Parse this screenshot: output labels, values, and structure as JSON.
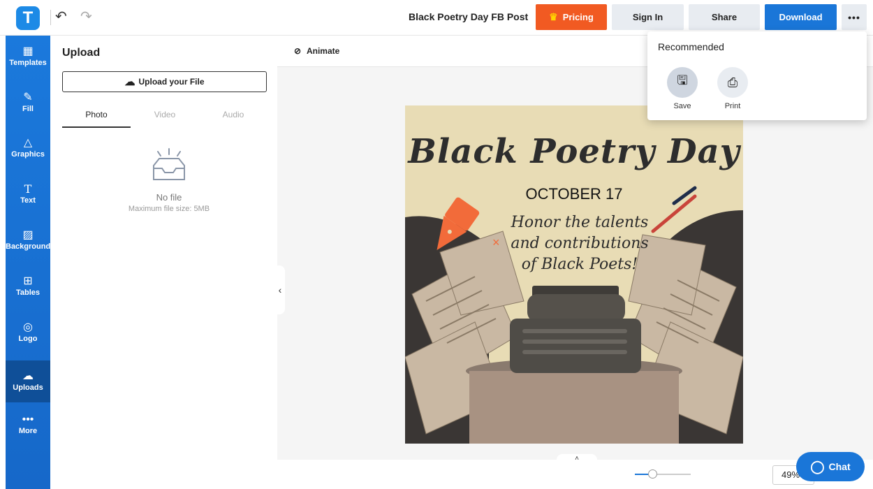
{
  "header": {
    "logo_letter": "T",
    "document_title": "Black Poetry Day FB Post",
    "pricing_label": "Pricing",
    "signin_label": "Sign In",
    "share_label": "Share",
    "download_label": "Download",
    "more_label": "•••"
  },
  "sidebar": {
    "items": [
      {
        "label": "Templates",
        "icon": "templates-icon"
      },
      {
        "label": "Fill",
        "icon": "pencil-icon"
      },
      {
        "label": "Graphics",
        "icon": "shapes-icon"
      },
      {
        "label": "Text",
        "icon": "text-icon"
      },
      {
        "label": "Background",
        "icon": "background-icon"
      },
      {
        "label": "Tables",
        "icon": "table-icon"
      },
      {
        "label": "Logo",
        "icon": "logo-icon"
      },
      {
        "label": "Uploads",
        "icon": "cloud-upload-icon",
        "active": true
      },
      {
        "label": "More",
        "icon": "more-icon"
      }
    ]
  },
  "panel": {
    "title": "Upload",
    "upload_button": "Upload your File",
    "tabs": [
      "Photo",
      "Video",
      "Audio"
    ],
    "active_tab": "Photo",
    "empty_title": "No file",
    "empty_subtitle": "Maximum file size: 5MB"
  },
  "canvas": {
    "animate_label": "Animate",
    "zoom": "49%",
    "zoom_fraction": 0.49
  },
  "poster": {
    "title": "Black Poetry Day",
    "date": "OCTOBER 17",
    "lines": [
      "Honor the talents",
      "and contributions",
      "of Black Poets!"
    ],
    "colors": {
      "background": "#e8dcb5",
      "chalkboard": "#3a3634",
      "paper": "#c9b8a3",
      "pen": "#f26b3a",
      "pedestal": "#a89282",
      "typewriter": "#4f4c47"
    }
  },
  "dropdown": {
    "title": "Recommended",
    "items": [
      {
        "label": "Save",
        "icon": "save-icon",
        "active": true
      },
      {
        "label": "Print",
        "icon": "print-icon"
      }
    ]
  },
  "chat": {
    "label": "Chat"
  },
  "colors": {
    "accent": "#1a76d8",
    "pricing": "#f15a22",
    "sidebar": "#1b79dc"
  }
}
